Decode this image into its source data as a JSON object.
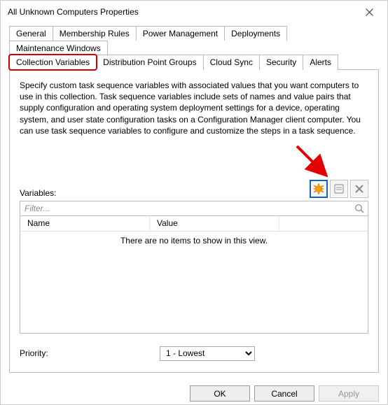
{
  "titlebar": {
    "title": "All Unknown Computers Properties"
  },
  "tabs": {
    "row1": [
      "General",
      "Membership Rules",
      "Power Management",
      "Deployments",
      "Maintenance Windows"
    ],
    "row2": [
      "Collection Variables",
      "Distribution Point Groups",
      "Cloud Sync",
      "Security",
      "Alerts"
    ],
    "active": "Collection Variables"
  },
  "panel": {
    "description": "Specify custom task sequence variables with associated values that you want computers to use in this collection. Task sequence variables include sets of names and value pairs that supply configuration and operating system deployment settings for a device, operating system, and user state configuration tasks on a Configuration Manager client computer. You can use task sequence variables to configure and customize the steps in a task sequence.",
    "variables_label": "Variables:",
    "filter_placeholder": "Filter...",
    "columns": {
      "name": "Name",
      "value": "Value"
    },
    "empty_text": "There are no items to show in this view.",
    "priority_label": "Priority:",
    "priority_value": "1 - Lowest"
  },
  "toolbar_icons": {
    "new": "new-starburst-icon",
    "edit": "properties-icon",
    "delete": "delete-x-icon"
  },
  "buttons": {
    "ok": "OK",
    "cancel": "Cancel",
    "apply": "Apply"
  }
}
